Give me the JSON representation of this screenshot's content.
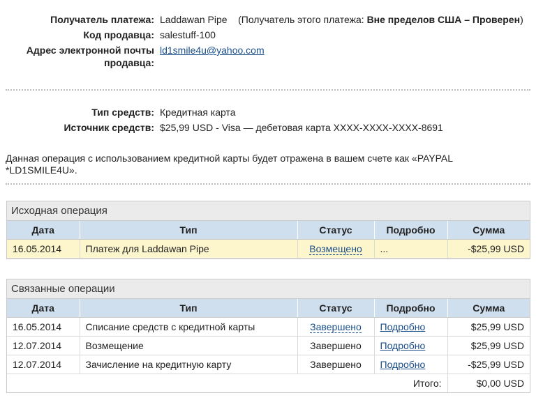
{
  "payee": {
    "label": "Получатель платежа:",
    "name": "Laddawan Pipe",
    "note_prefix": "(Получатель этого платежа: ",
    "note_status": "Вне пределов США – Проверен",
    "note_suffix": ")"
  },
  "seller_code": {
    "label": "Код продавца:",
    "value": "salestuff-100"
  },
  "seller_email": {
    "label": "Адрес электронной почты продавца:",
    "value": "ld1smile4u@yahoo.com"
  },
  "funding_type": {
    "label": "Тип средств:",
    "value": "Кредитная карта"
  },
  "funding_source": {
    "label": "Источник средств:",
    "value": "$25,99 USD - Visa — дебетовая карта XXXX-XXXX-XXXX-8691"
  },
  "note": "Данная операция с использованием кредитной карты будет отражена в вашем счете как «PAYPAL *LD1SMILE4U».",
  "original": {
    "title": "Исходная операция",
    "headers": [
      "Дата",
      "Тип",
      "Статус",
      "Подробно",
      "Сумма"
    ],
    "rows": [
      {
        "date": "16.05.2014",
        "type": "Платеж для Laddawan Pipe",
        "status": "Возмещено",
        "details": "...",
        "amount": "-$25,99 USD"
      }
    ]
  },
  "related": {
    "title": "Связанные операции",
    "headers": [
      "Дата",
      "Тип",
      "Статус",
      "Подробно",
      "Сумма"
    ],
    "rows": [
      {
        "date": "16.05.2014",
        "type": "Списание средств с кредитной карты",
        "status": "Завершено",
        "details": "Подробно",
        "amount": "$25,99 USD"
      },
      {
        "date": "12.07.2014",
        "type": "Возмещение",
        "status": "Завершено",
        "details": "Подробно",
        "amount": "$25,99 USD"
      },
      {
        "date": "12.07.2014",
        "type": "Зачисление на кредитную карту",
        "status": "Завершено",
        "details": "Подробно",
        "amount": "-$25,99 USD"
      }
    ],
    "total_label": "Итого:",
    "total_value": "$0,00 USD"
  }
}
